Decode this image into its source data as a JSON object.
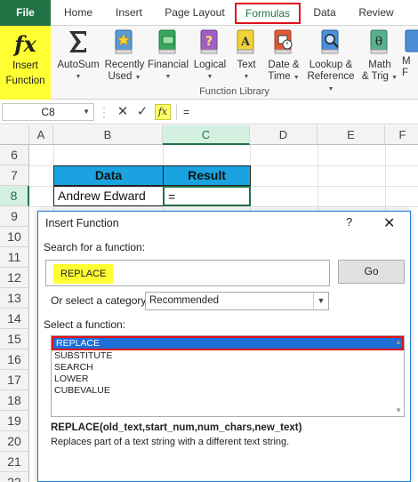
{
  "tabs": [
    {
      "label": "File"
    },
    {
      "label": "Home"
    },
    {
      "label": "Insert"
    },
    {
      "label": "Page Layout"
    },
    {
      "label": "Formulas"
    },
    {
      "label": "Data"
    },
    {
      "label": "Review"
    }
  ],
  "ribbon": {
    "insert_function": "Insert Function",
    "insert_function_line1": "Insert",
    "insert_function_line2": "Function",
    "buttons": [
      {
        "line1": "AutoSum",
        "line2": "",
        "icon": "sigma-icon"
      },
      {
        "line1": "Recently",
        "line2": "Used",
        "icon": "star-book-icon"
      },
      {
        "line1": "Financial",
        "line2": "",
        "icon": "money-book-icon"
      },
      {
        "line1": "Logical",
        "line2": "",
        "icon": "question-book-icon"
      },
      {
        "line1": "Text",
        "line2": "",
        "icon": "text-book-icon"
      },
      {
        "line1": "Date &",
        "line2": "Time",
        "icon": "calendar-book-icon"
      },
      {
        "line1": "Lookup &",
        "line2": "Reference",
        "icon": "magnifier-book-icon"
      },
      {
        "line1": "Math",
        "line2": "& Trig",
        "icon": "theta-book-icon"
      },
      {
        "line1": "M",
        "line2": "F",
        "icon": "more-book-icon"
      }
    ],
    "group_label": "Function Library"
  },
  "formula_bar": {
    "name_box": "C8",
    "cancel": "✕",
    "enter": "✓",
    "fx": "fx",
    "value": "="
  },
  "grid": {
    "columns": [
      "A",
      "B",
      "C",
      "D",
      "E",
      "F"
    ],
    "rows": [
      "6",
      "7",
      "8",
      "9",
      "10",
      "11",
      "12",
      "13",
      "14",
      "15",
      "16",
      "17",
      "18",
      "19",
      "20",
      "21",
      "22"
    ],
    "header_data": "Data",
    "header_result": "Result",
    "value_data": "Andrew Edward",
    "value_result": "="
  },
  "dialog": {
    "title": "Insert Function",
    "help": "?",
    "close": "✕",
    "search_label": "Search for a function:",
    "search_value": "REPLACE",
    "go_label": "Go",
    "category_label": "Or select a category:",
    "category_value": "Recommended",
    "select_label": "Select a function:",
    "functions": [
      "REPLACE",
      "SUBSTITUTE",
      "SEARCH",
      "LOWER",
      "CUBEVALUE"
    ],
    "signature": "REPLACE(old_text,start_num,num_chars,new_text)",
    "description": "Replaces part of a text string with a different text string."
  },
  "colors": {
    "excel_green": "#217346",
    "highlight_yellow": "#ffff33",
    "header_blue": "#1aa3e0",
    "selection_blue": "#1e6fd6",
    "annotation_red": "#e0101a"
  }
}
